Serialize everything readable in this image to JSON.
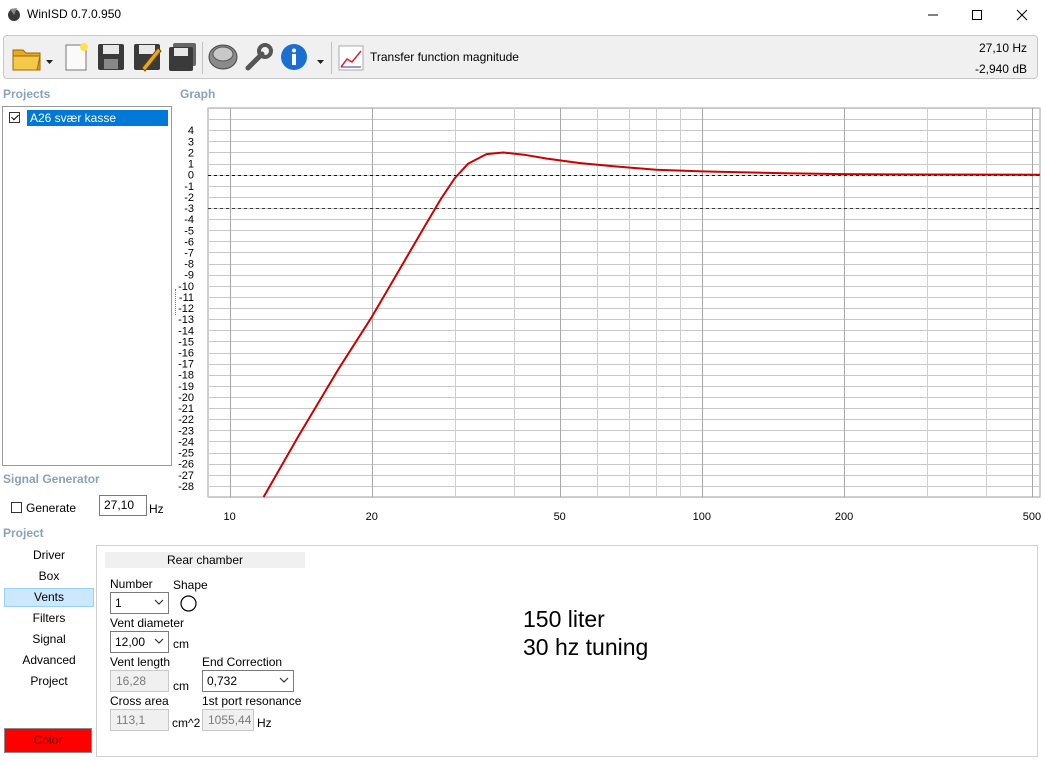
{
  "window": {
    "title": "WinISD 0.7.0.950"
  },
  "toolbar": {
    "transfer_label": "Transfer function magnitude",
    "readout_freq": "27,10 Hz",
    "readout_db": "-2,940 dB"
  },
  "projects": {
    "title": "Projects",
    "items": [
      {
        "label": "A26 svær kasse",
        "checked": true
      }
    ]
  },
  "graph": {
    "title": "Graph"
  },
  "chart_data": {
    "type": "line",
    "x_scale": "log",
    "xlim": [
      9,
      520
    ],
    "ylim": [
      -29,
      6
    ],
    "x_ticks": [
      10,
      20,
      50,
      100,
      200,
      500
    ],
    "y_ticks": [
      4,
      3,
      2,
      1,
      0,
      -1,
      -2,
      -3,
      -4,
      -5,
      -6,
      -7,
      -8,
      -9,
      -10,
      -11,
      -12,
      -13,
      -14,
      -15,
      -16,
      -17,
      -18,
      -19,
      -20,
      -21,
      -22,
      -23,
      -24,
      -25,
      -26,
      -27,
      -28
    ],
    "reference_lines": [
      0,
      -3
    ],
    "series": [
      {
        "color": "#cc0000",
        "x": [
          11.8,
          14,
          17,
          20,
          23,
          26,
          28,
          30,
          32,
          35,
          38,
          42,
          47,
          55,
          65,
          80,
          100,
          150,
          200,
          300,
          520
        ],
        "y": [
          -29,
          -23.5,
          -17.5,
          -12.8,
          -8.4,
          -4.5,
          -2.2,
          -0.3,
          1.0,
          1.85,
          2.0,
          1.8,
          1.45,
          1.05,
          0.75,
          0.45,
          0.3,
          0.13,
          0.05,
          0.02,
          0
        ]
      }
    ]
  },
  "signal_generator": {
    "title": "Signal Generator",
    "generate_label": "Generate",
    "generate_checked": false,
    "frequency": "27,10",
    "unit": "Hz"
  },
  "project_nav": {
    "title": "Project",
    "items": [
      "Driver",
      "Box",
      "Vents",
      "Filters",
      "Signal",
      "Advanced",
      "Project"
    ],
    "active": "Vents",
    "color_button": "Color"
  },
  "vents": {
    "section": "Rear chamber",
    "number_label": "Number",
    "number_value": "1",
    "shape_label": "Shape",
    "diameter_label": "Vent diameter",
    "diameter_value": "12,00",
    "diameter_unit": "cm",
    "length_label": "Vent length",
    "length_value": "16,28",
    "length_unit": "cm",
    "end_correction_label": "End Correction",
    "end_correction_value": "0,732",
    "cross_area_label": "Cross area",
    "cross_area_value": "113,1",
    "cross_area_unit": "cm^2",
    "resonance_label": "1st port resonance",
    "resonance_value": "1055,44",
    "resonance_unit": "Hz"
  },
  "notes": {
    "line1": "150 liter",
    "line2": "30 hz tuning"
  }
}
